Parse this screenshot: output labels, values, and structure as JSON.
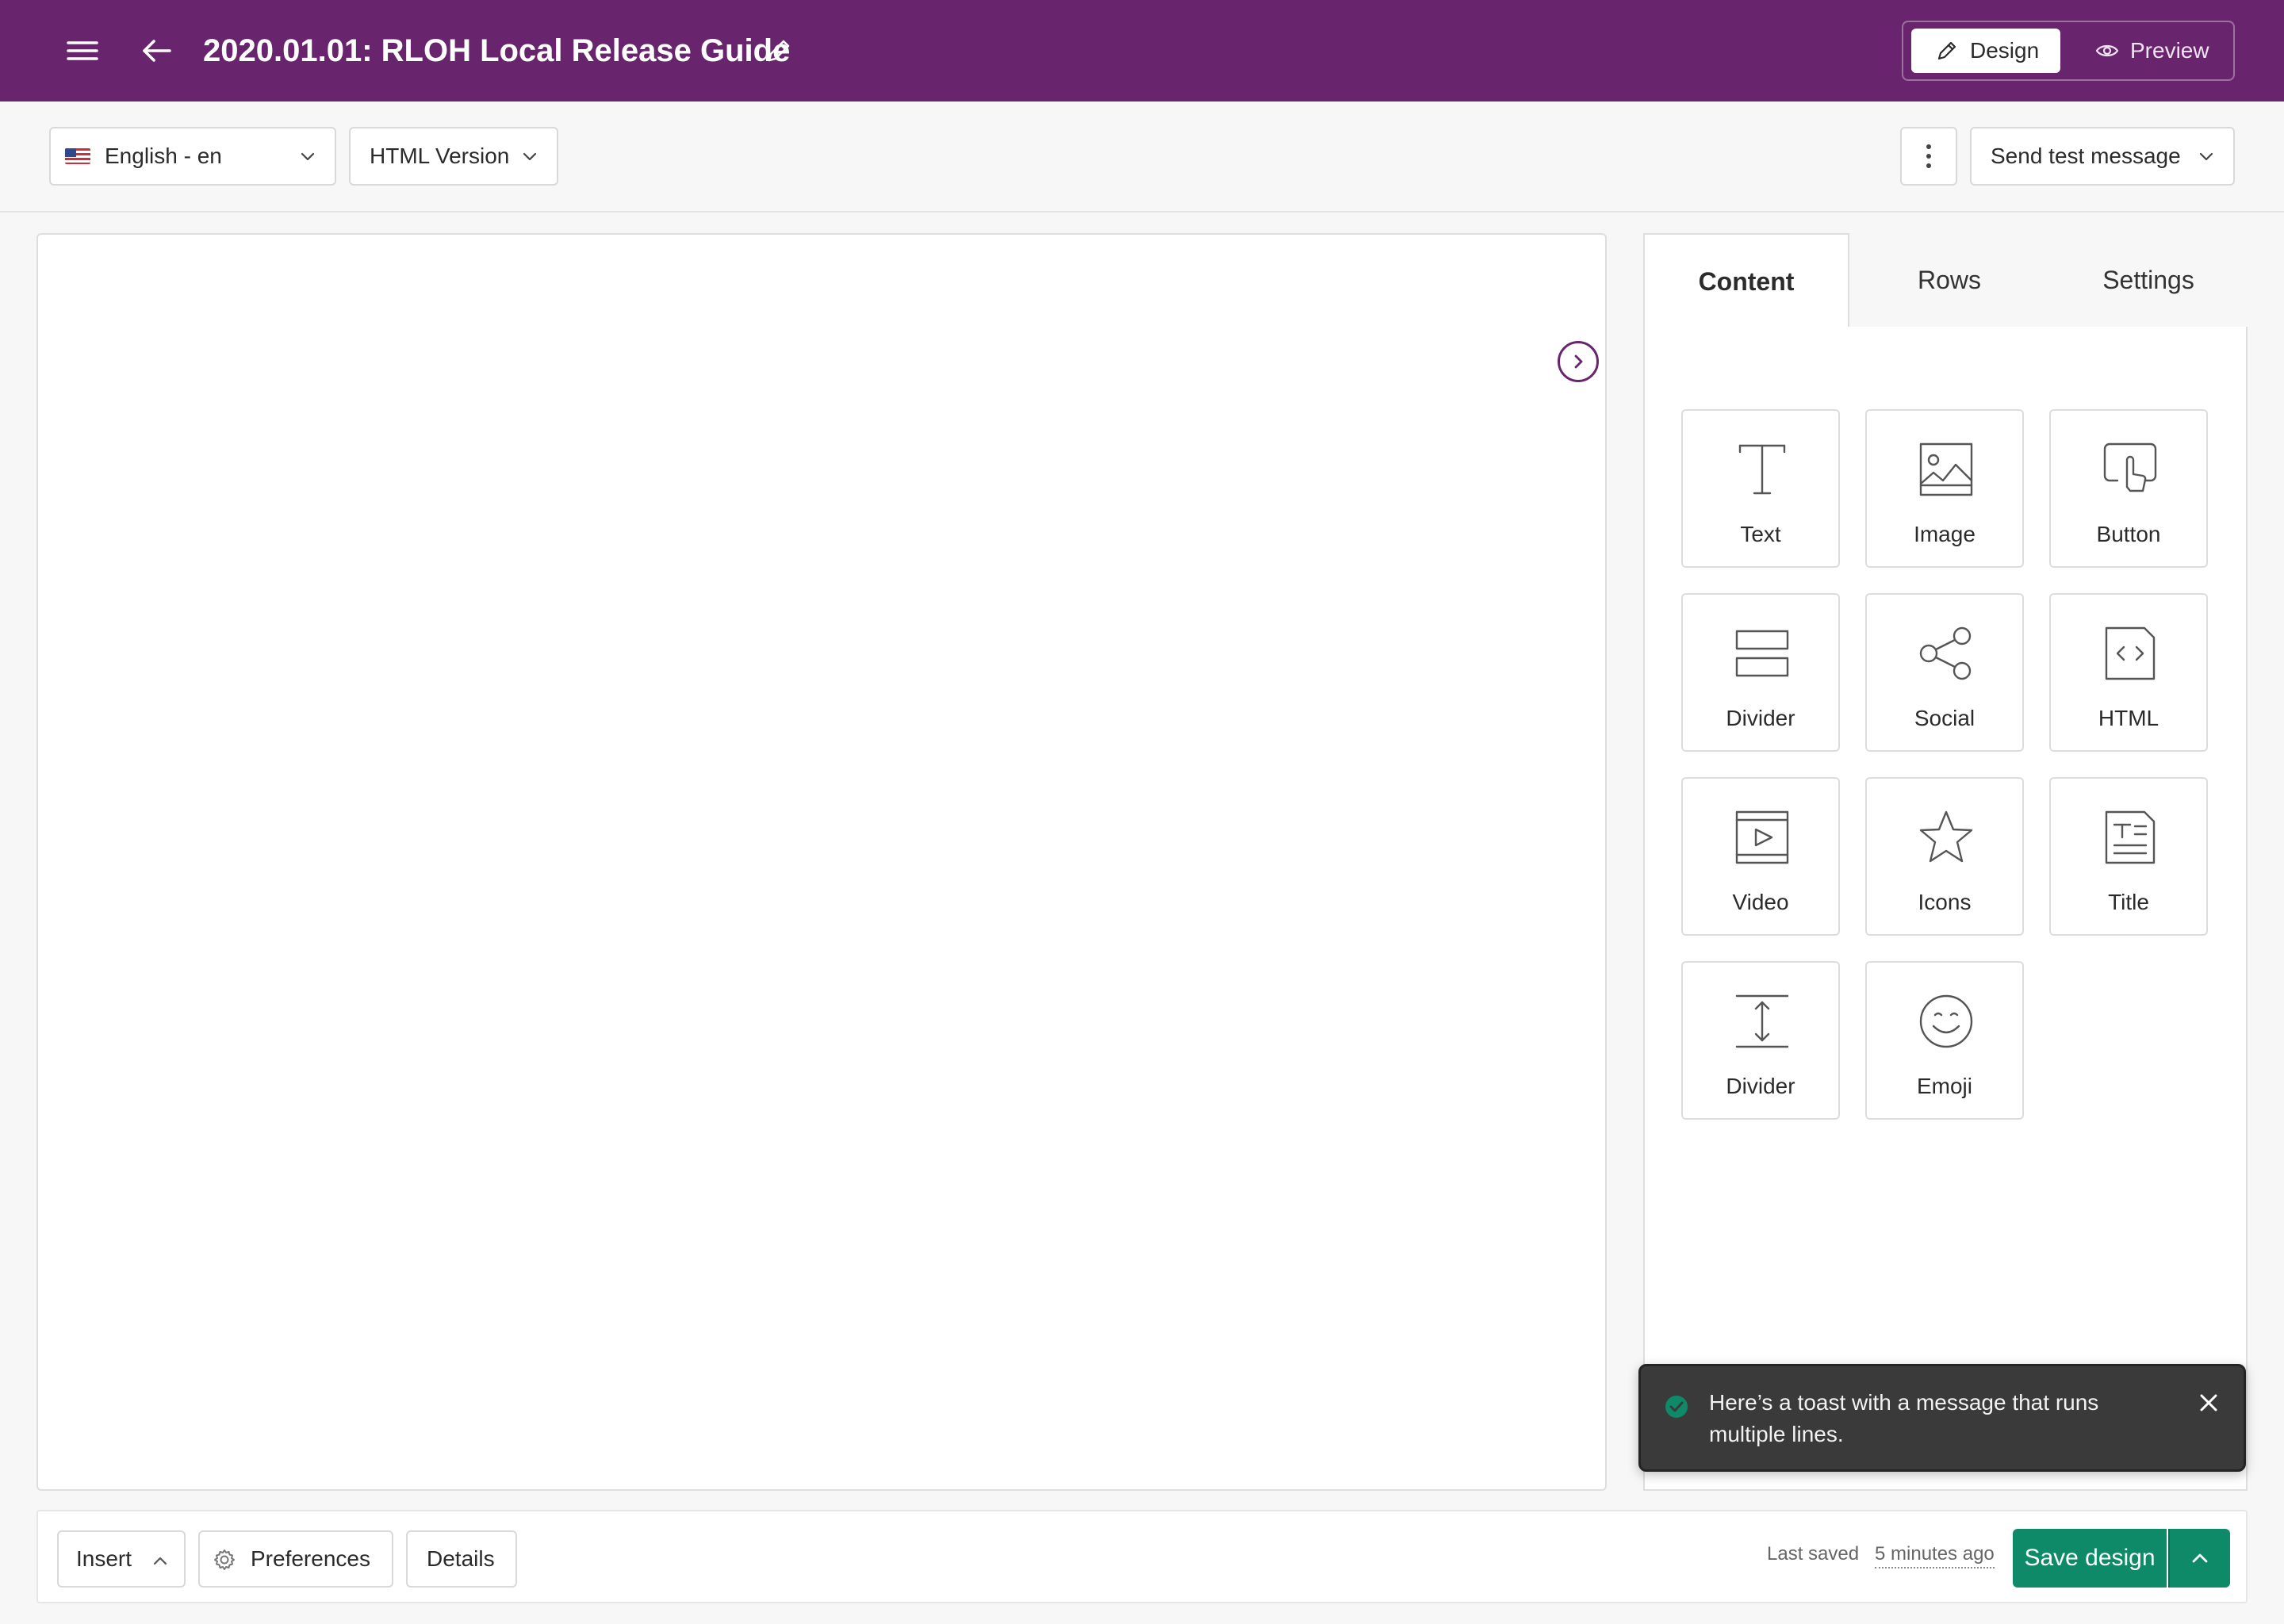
{
  "header": {
    "title": "2020.01.01: RLOH Local Release Guide",
    "modes": {
      "design": "Design",
      "preview": "Preview"
    },
    "colors": {
      "brand": "#69246e"
    }
  },
  "toolbar": {
    "language": "English - en",
    "version": "HTML Version",
    "send_test": "Send test message"
  },
  "panel": {
    "tabs": {
      "content": "Content",
      "rows": "Rows",
      "settings": "Settings"
    },
    "tools": [
      {
        "label": "Text",
        "icon": "text-icon"
      },
      {
        "label": "Image",
        "icon": "image-icon"
      },
      {
        "label": "Button",
        "icon": "button-icon"
      },
      {
        "label": "Divider",
        "icon": "divider-icon"
      },
      {
        "label": "Social",
        "icon": "social-icon"
      },
      {
        "label": "HTML",
        "icon": "html-icon"
      },
      {
        "label": "Video",
        "icon": "video-icon"
      },
      {
        "label": "Icons",
        "icon": "star-icon"
      },
      {
        "label": "Title",
        "icon": "title-icon"
      },
      {
        "label": "Divider",
        "icon": "spacer-icon"
      },
      {
        "label": "Emoji",
        "icon": "emoji-icon"
      }
    ]
  },
  "toast": {
    "message": "Here’s a toast with a message that runs multiple lines.",
    "color": "#0e8a68"
  },
  "bottom": {
    "insert": "Insert",
    "preferences": "Preferences",
    "details": "Details",
    "last_saved_label": "Last saved",
    "last_saved_time": "5 minutes ago",
    "save": "Save design",
    "colors": {
      "save": "#0e8a68"
    }
  }
}
